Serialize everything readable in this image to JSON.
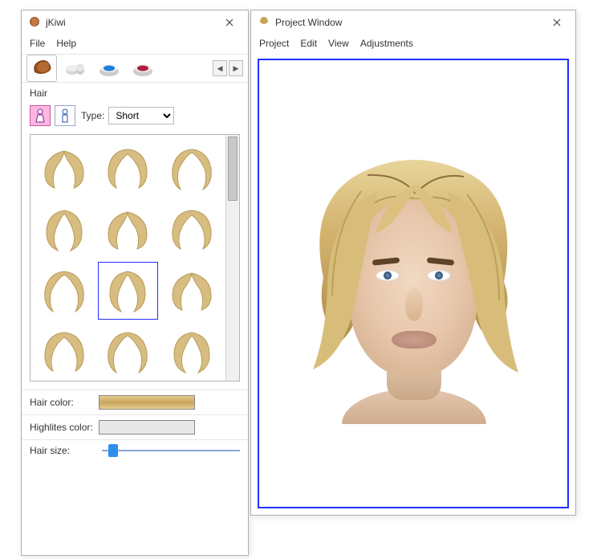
{
  "leftWindow": {
    "title": "jKiwi",
    "menu": {
      "file": "File",
      "help": "Help"
    },
    "tabs": {
      "selected": 0
    },
    "section_label": "Hair",
    "gender": {
      "selected": "female"
    },
    "type_label": "Type:",
    "type_value": "Short",
    "gallery": {
      "rows": 4,
      "cols": 3,
      "count": 12,
      "selected_index": 7
    },
    "settings": {
      "hair_color_label": "Hair color:",
      "highlites_label": "Highlites color:",
      "hair_size_label": "Hair size:"
    }
  },
  "rightWindow": {
    "title": "Project Window",
    "menu": {
      "project": "Project",
      "edit": "Edit",
      "view": "View",
      "adjustments": "Adjustments"
    }
  }
}
